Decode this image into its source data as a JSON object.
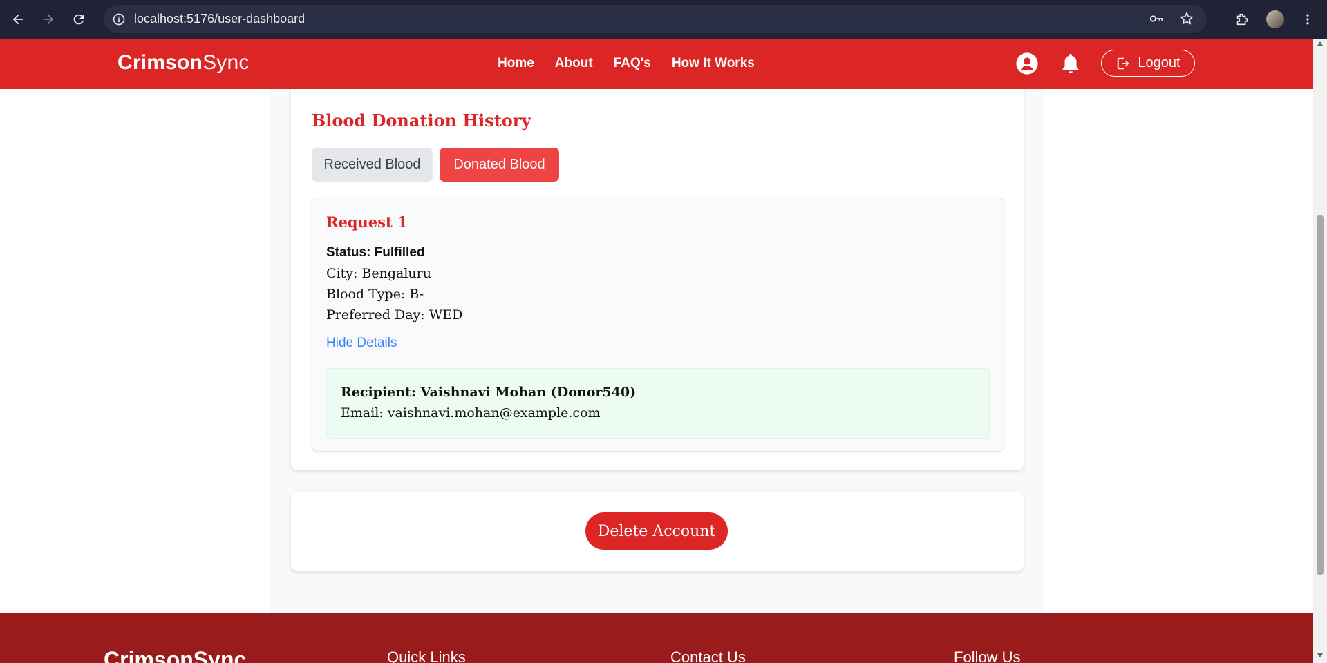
{
  "browser": {
    "url": "localhost:5176/user-dashboard"
  },
  "header": {
    "brand_bold": "Crimson",
    "brand_light": "Sync",
    "nav": [
      "Home",
      "About",
      "FAQ's",
      "How It Works"
    ],
    "logout_label": "Logout"
  },
  "history": {
    "title": "Blood Donation History",
    "tabs": {
      "received": "Received Blood",
      "donated": "Donated Blood"
    },
    "active_tab": "donated",
    "request": {
      "title": "Request 1",
      "status": "Status: Fulfilled",
      "city": "City: Bengaluru",
      "blood_type": "Blood Type: B-",
      "preferred_day": "Preferred Day: WED",
      "toggle_label": "Hide Details",
      "recipient": "Recipient: Vaishnavi Mohan (Donor540)",
      "email": "Email: vaishnavi.mohan@example.com"
    }
  },
  "account": {
    "delete_label": "Delete Account"
  },
  "footer": {
    "brand": "CrimsonSync",
    "columns": [
      "Quick Links",
      "Contact Us",
      "Follow Us"
    ]
  },
  "colors": {
    "brand_red": "#dc2626",
    "footer_red": "#991b1b",
    "link_blue": "#3b82f6",
    "recipient_bg": "#edfcf2"
  }
}
